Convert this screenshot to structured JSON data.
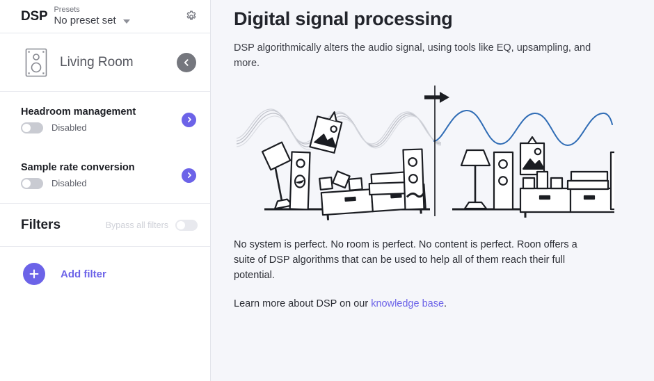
{
  "sidebar": {
    "logo": "DSP",
    "preset_label": "Presets",
    "preset_value": "No preset set",
    "caret_icon": "chevron-down-icon",
    "gear_icon": "gear-icon",
    "room": {
      "icon": "speaker-icon",
      "name": "Living Room",
      "back_icon": "chevron-left-icon"
    },
    "settings": [
      {
        "title": "Headroom management",
        "state": "Disabled",
        "toggle_on": false,
        "chevron_icon": "chevron-right-icon"
      },
      {
        "title": "Sample rate conversion",
        "state": "Disabled",
        "toggle_on": false,
        "chevron_icon": "chevron-right-icon"
      }
    ],
    "filters": {
      "title": "Filters",
      "bypass_label": "Bypass all filters",
      "bypass_on": false,
      "add_label": "Add filter",
      "plus_icon": "plus-icon"
    }
  },
  "main": {
    "title": "Digital signal processing",
    "lead": "DSP algorithmically alters the audio signal, using tools like EQ, upsampling, and more.",
    "illustration_name": "dsp-before-after-illustration",
    "paragraph": "No system is perfect. No room is perfect. No content is perfect. Roon offers a suite of DSP algorithms that can be used to help all of them reach their full potential.",
    "learn_prefix": "Learn more about DSP on our ",
    "learn_link": "knowledge base",
    "learn_suffix": "."
  },
  "colors": {
    "accent": "#6c63e8",
    "background": "#f5f6fa",
    "sidebar": "#ffffff",
    "wave_clean": "#2f6cb5",
    "wave_distorted": "#b9bbc4",
    "text": "#22242b"
  }
}
